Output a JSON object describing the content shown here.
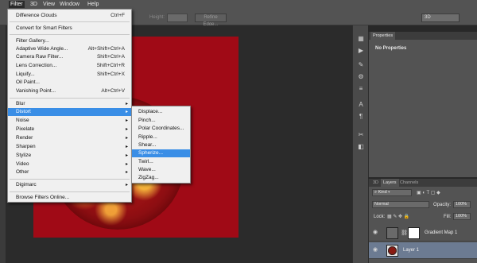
{
  "menubar": {
    "items": [
      "Filter",
      "3D",
      "View",
      "Window",
      "Help"
    ]
  },
  "options_bar": {
    "height_label": "Height:",
    "refine_edge": "Refine Edge...",
    "workspace": "3D"
  },
  "filter_menu": {
    "items": [
      {
        "label": "Difference Clouds",
        "shortcut": "Ctrl+F"
      },
      {
        "label": "Convert for Smart Filters",
        "shortcut": ""
      },
      {
        "label": "Filter Gallery...",
        "shortcut": ""
      },
      {
        "label": "Adaptive Wide Angle...",
        "shortcut": "Alt+Shift+Ctrl+A"
      },
      {
        "label": "Camera Raw Filter...",
        "shortcut": "Shift+Ctrl+A"
      },
      {
        "label": "Lens Correction...",
        "shortcut": "Shift+Ctrl+R"
      },
      {
        "label": "Liquify...",
        "shortcut": "Shift+Ctrl+X"
      },
      {
        "label": "Oil Paint...",
        "shortcut": ""
      },
      {
        "label": "Vanishing Point...",
        "shortcut": "Alt+Ctrl+V"
      },
      {
        "label": "Blur",
        "shortcut": ""
      },
      {
        "label": "Distort",
        "shortcut": ""
      },
      {
        "label": "Noise",
        "shortcut": ""
      },
      {
        "label": "Pixelate",
        "shortcut": ""
      },
      {
        "label": "Render",
        "shortcut": ""
      },
      {
        "label": "Sharpen",
        "shortcut": ""
      },
      {
        "label": "Stylize",
        "shortcut": ""
      },
      {
        "label": "Video",
        "shortcut": ""
      },
      {
        "label": "Other",
        "shortcut": ""
      },
      {
        "label": "Digimarc",
        "shortcut": ""
      },
      {
        "label": "Browse Filters Online...",
        "shortcut": ""
      }
    ]
  },
  "distort_submenu": {
    "items": [
      "Displace...",
      "Pinch...",
      "Polar Coordinates...",
      "Ripple...",
      "Shear...",
      "Spherize...",
      "Twirl...",
      "Wave...",
      "ZigZag..."
    ],
    "highlighted": "Spherize..."
  },
  "properties_panel": {
    "tab": "Properties",
    "content": "No Properties"
  },
  "layers_panel": {
    "tabs": [
      "3D",
      "Layers",
      "Channels"
    ],
    "kind_filter": "Kind",
    "blend_mode": "Normal",
    "opacity_label": "Opacity:",
    "opacity_value": "100%",
    "lock_label": "Lock:",
    "fill_label": "Fill:",
    "fill_value": "100%",
    "layers": [
      {
        "name": "Gradient Map 1",
        "selected": false
      },
      {
        "name": "Layer 1",
        "selected": true
      }
    ]
  },
  "colors": {
    "highlight": "#3a8ee6",
    "canvas": "#a00a16",
    "selected_layer": "#6c7b92"
  }
}
